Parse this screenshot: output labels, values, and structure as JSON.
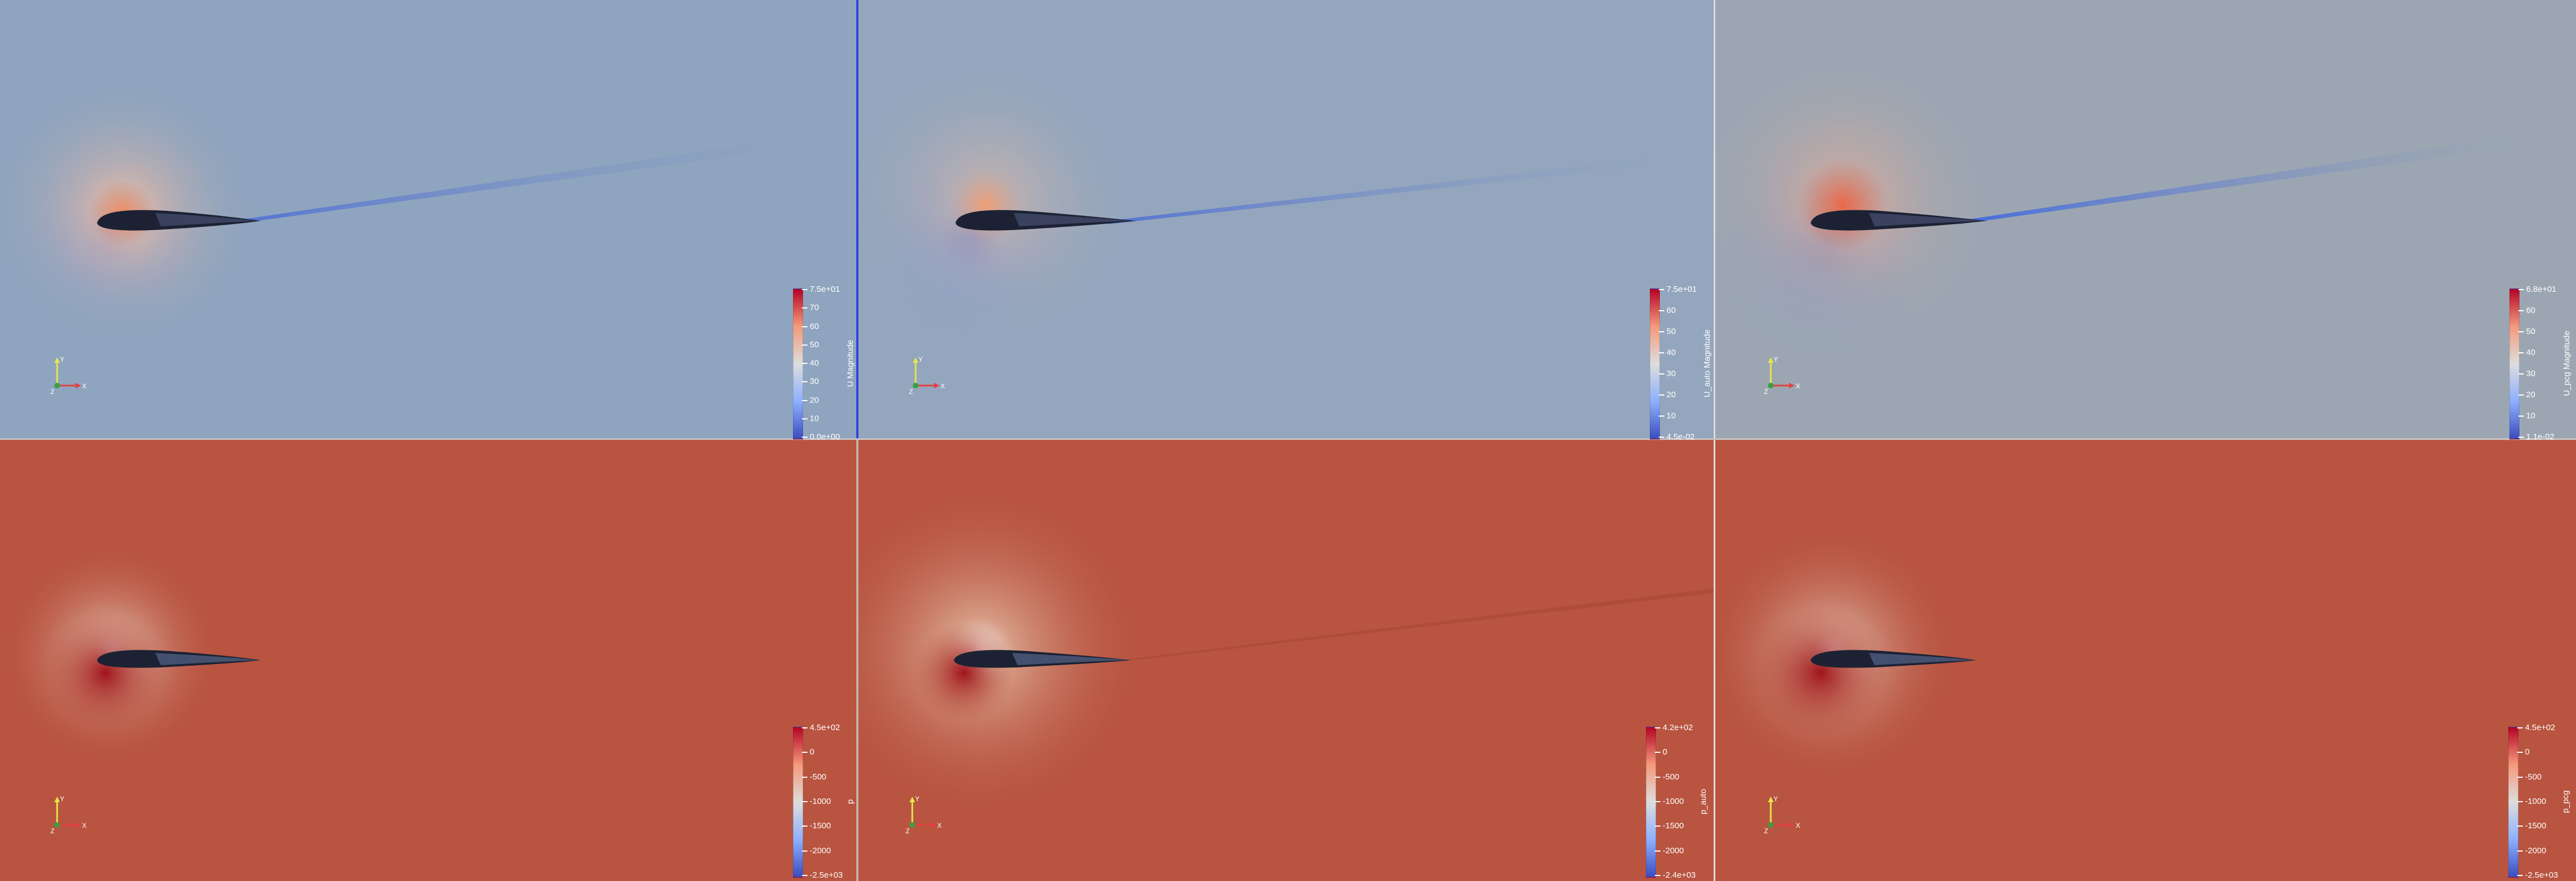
{
  "app": {
    "layout": "2x3 render view grid"
  },
  "colors": {
    "active_view_border": "#3040e0",
    "view_separator": "#dddddd",
    "colormap": [
      "#3b4cc0",
      "#8db0fe",
      "#dddddd",
      "#f49a7b",
      "#b40426"
    ],
    "velocity_background": "#8fa4be",
    "velocity_background_pcg": "#9ca6b2",
    "pressure_background": "#b85440",
    "airfoil_shadow": "#1c2233"
  },
  "views": [
    {
      "field": "U",
      "colorbar": {
        "title": "U Magnitude",
        "labels": [
          "7.5e+01",
          "70",
          "60",
          "50",
          "40",
          "30",
          "20",
          "10",
          "0.0e+00"
        ]
      },
      "axes": {
        "y_label": "Y",
        "x_label": "X",
        "z_label": "Z"
      },
      "active": true
    },
    {
      "field": "U_auto",
      "colorbar": {
        "title": "U_auto Magnitude",
        "labels": [
          "7.5e+01",
          "60",
          "50",
          "40",
          "30",
          "20",
          "10",
          "4.5e-02"
        ]
      },
      "axes": {
        "y_label": "Y",
        "x_label": "X",
        "z_label": "Z"
      },
      "active": false
    },
    {
      "field": "U_pcg",
      "colorbar": {
        "title": "U_pcg Magnitude",
        "labels": [
          "6.8e+01",
          "60",
          "50",
          "40",
          "30",
          "20",
          "10",
          "1.1e-02"
        ]
      },
      "axes": {
        "y_label": "Y",
        "x_label": "X",
        "z_label": "Z"
      },
      "active": false
    },
    {
      "field": "p",
      "colorbar": {
        "title": "p",
        "labels": [
          "4.5e+02",
          "0",
          "-500",
          "-1000",
          "-1500",
          "-2000",
          "-2.5e+03"
        ]
      },
      "axes": {
        "y_label": "Y",
        "x_label": "X",
        "z_label": "Z"
      },
      "active": false
    },
    {
      "field": "p_auto",
      "colorbar": {
        "title": "p_auto",
        "labels": [
          "4.2e+02",
          "0",
          "-500",
          "-1000",
          "-1500",
          "-2000",
          "-2.4e+03"
        ]
      },
      "axes": {
        "y_label": "Y",
        "x_label": "X",
        "z_label": "Z"
      },
      "active": false
    },
    {
      "field": "p_pcg",
      "colorbar": {
        "title": "p_pcg",
        "labels": [
          "4.5e+02",
          "0",
          "-500",
          "-1000",
          "-1500",
          "-2000",
          "-2.5e+03"
        ]
      },
      "axes": {
        "y_label": "Y",
        "x_label": "X",
        "z_label": "Z"
      },
      "active": false
    }
  ]
}
